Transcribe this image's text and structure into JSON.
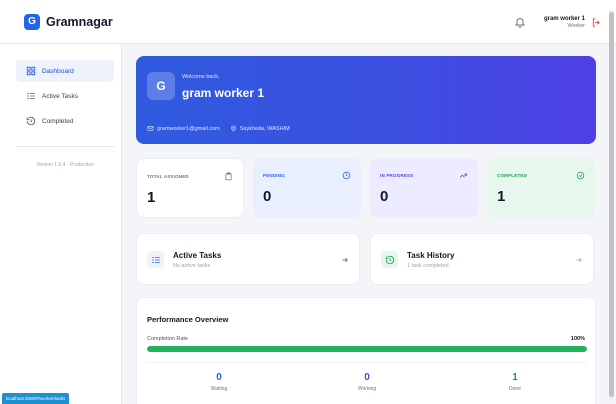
{
  "app": {
    "logo_letter": "G",
    "name": "Gramnagar"
  },
  "topbar": {
    "user_name": "gram worker 1",
    "user_role": "Worker"
  },
  "sidebar": {
    "items": [
      {
        "label": "Dashboard"
      },
      {
        "label": "Active Tasks"
      },
      {
        "label": "Completed"
      }
    ],
    "version": "Version 1.0.4 - Production"
  },
  "hero": {
    "avatar_letter": "G",
    "welcome": "Welcome back,",
    "name": "gram worker 1",
    "email": "gramworker1@gmail.com",
    "location": "Saykheda, WASHIM"
  },
  "stats": [
    {
      "label": "TOTAL ASSIGNED",
      "value": "1"
    },
    {
      "label": "PENDING",
      "value": "0"
    },
    {
      "label": "IN PROGRESS",
      "value": "0"
    },
    {
      "label": "COMPLETED",
      "value": "1"
    }
  ],
  "links": {
    "active": {
      "title": "Active Tasks",
      "subtitle": "No active tasks"
    },
    "history": {
      "title": "Task History",
      "subtitle": "1 task completed"
    }
  },
  "performance": {
    "title": "Performance Overview",
    "rate_label": "Completion Rate",
    "rate_value": "100%",
    "rate_fraction": 1.0,
    "stats": [
      {
        "value": "0",
        "label": "Waiting"
      },
      {
        "value": "0",
        "label": "Working"
      },
      {
        "value": "1",
        "label": "Done"
      }
    ]
  },
  "status_bar": {
    "url": "localhost:3000/#/worker/tasks"
  },
  "colors": {
    "accent": "#2563eb",
    "pending": "#2563eb",
    "in_progress": "#4f46e5",
    "completed": "#16a34a",
    "progress_bar": "#22b35e"
  },
  "icons": {
    "bell": "bell-icon",
    "logout": "logout-icon",
    "dashboard": "grid-icon",
    "active_tasks": "list-icon",
    "completed": "history-icon",
    "email": "mail-icon",
    "location": "pin-icon",
    "total": "clipboard-icon",
    "pending": "clock-icon",
    "in_progress": "trend-icon",
    "done": "check-circle-icon",
    "arrow": "arrow-right-icon"
  }
}
